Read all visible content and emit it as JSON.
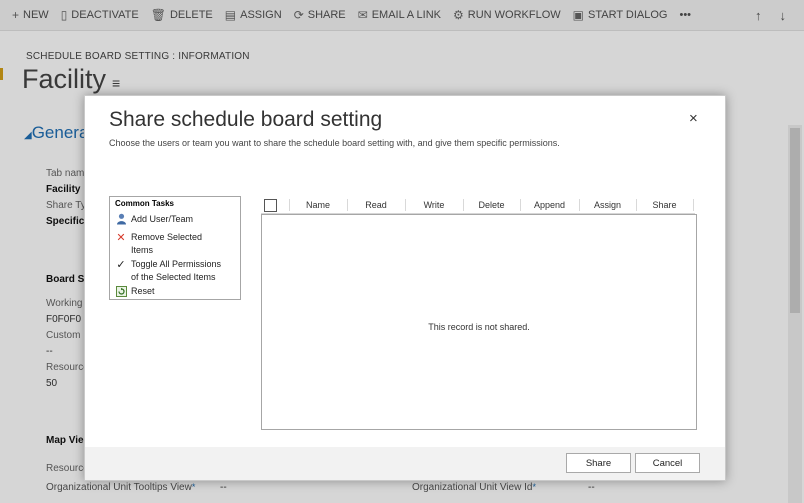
{
  "command_bar": {
    "new": "NEW",
    "deactivate": "DEACTIVATE",
    "delete": "DELETE",
    "assign": "ASSIGN",
    "share": "SHARE",
    "email_link": "EMAIL A LINK",
    "run_workflow": "RUN WORKFLOW",
    "start_dialog": "START DIALOG",
    "more": "•••"
  },
  "background": {
    "breadcrumb": "SCHEDULE BOARD SETTING : INFORMATION",
    "title": "Facility",
    "general_section": "Genera",
    "tab_name_label": "Tab nam",
    "tab_name_value": "Facility",
    "share_type_label": "Share Ty",
    "share_type_value": "Specific",
    "board_settings_heading": "Board S",
    "working_label": "Working",
    "working_value": "F0F0F0",
    "custom_label": "Custom",
    "custom_value": "--",
    "resource_label": "Resource",
    "resource_value": "50",
    "map_view_heading": "Map Vie",
    "resource2_label": "Resource",
    "org_unit_tooltips_label": "Organizational Unit Tooltips View",
    "org_unit_tooltips_value": "--",
    "org_unit_view_id_label": "Organizational Unit View Id",
    "org_unit_view_id_value": "--"
  },
  "dialog": {
    "title": "Share schedule board setting",
    "subtitle": "Choose the users or team you want to share the schedule board setting with, and give them specific permissions.",
    "close": "×",
    "common_tasks": {
      "heading": "Common Tasks",
      "add_user_team": "Add User/Team",
      "remove_selected_1": "Remove Selected",
      "remove_selected_2": "Items",
      "toggle_all_1": "Toggle All Permissions",
      "toggle_all_2": "of the Selected Items",
      "reset": "Reset"
    },
    "grid": {
      "columns": [
        "Name",
        "Read",
        "Write",
        "Delete",
        "Append",
        "Assign",
        "Share"
      ],
      "empty_message": "This record is not shared."
    },
    "share_button": "Share",
    "cancel_button": "Cancel"
  }
}
